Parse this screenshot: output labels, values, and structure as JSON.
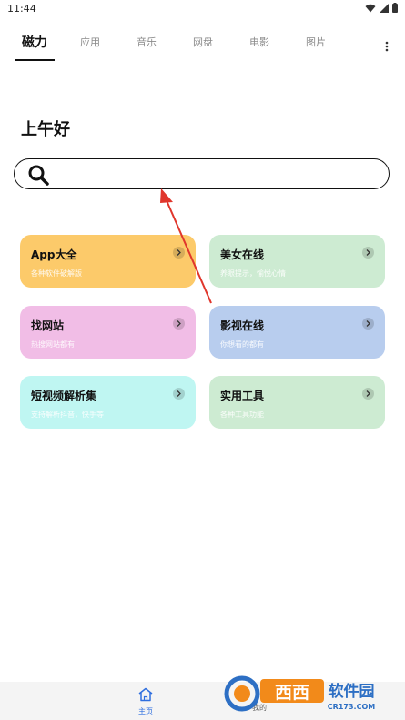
{
  "status": {
    "time": "11:44"
  },
  "tabs": [
    {
      "label": "磁力",
      "active": true
    },
    {
      "label": "应用",
      "active": false
    },
    {
      "label": "音乐",
      "active": false
    },
    {
      "label": "网盘",
      "active": false
    },
    {
      "label": "电影",
      "active": false
    },
    {
      "label": "图片",
      "active": false
    }
  ],
  "greeting": "上午好",
  "search": {
    "value": "",
    "placeholder": ""
  },
  "cards": [
    {
      "title": "App大全",
      "subtitle": "各种软件破解版",
      "color": "#fcca6a"
    },
    {
      "title": "美女在线",
      "subtitle": "养眼提示，愉悦心情",
      "color": "#cdebd2"
    },
    {
      "title": "找网站",
      "subtitle": "热搜网站都有",
      "color": "#f1bde6"
    },
    {
      "title": "影视在线",
      "subtitle": "你想看的都有",
      "color": "#b8cdee"
    },
    {
      "title": "短视频解析集",
      "subtitle": "支持解析抖音，快手等",
      "color": "#bff6f2"
    },
    {
      "title": "实用工具",
      "subtitle": "各种工具功能",
      "color": "#cdebd2"
    }
  ],
  "bottom_nav": [
    {
      "label": "主页",
      "active": true
    },
    {
      "label": "我的",
      "active": false
    }
  ],
  "watermark": {
    "brand": "西西软件园",
    "domain": "CR173.COM"
  },
  "colors": {
    "accent": "#2f6fdf",
    "annotation_arrow": "#e0362c"
  }
}
